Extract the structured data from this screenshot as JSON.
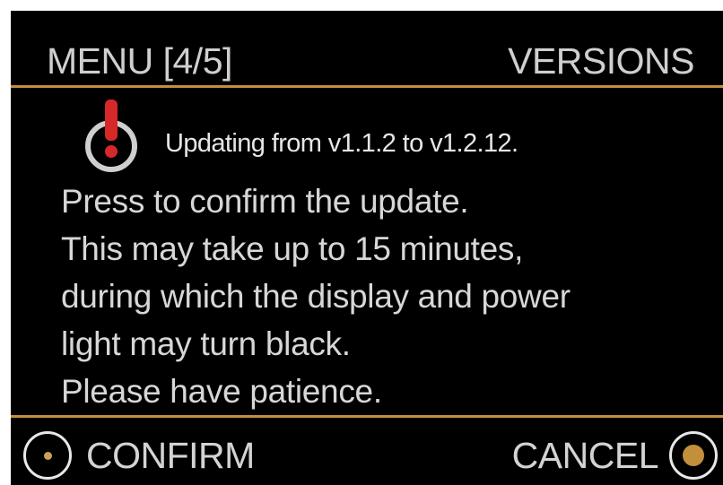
{
  "header": {
    "menu_label": "MENU [4/5]",
    "section_label": "VERSIONS"
  },
  "alert": {
    "icon": "power-alert-icon",
    "status_text": "Updating from v1.1.2 to v1.2.12."
  },
  "message": {
    "lines": [
      "Press to confirm the update.",
      "This may take up to 15 minutes,",
      "during which the display and power",
      "light may turn black.",
      "Please have patience."
    ]
  },
  "footer": {
    "confirm_label": "CONFIRM",
    "cancel_label": "CANCEL"
  },
  "colors": {
    "background": "#000000",
    "text": "#d9d9d9",
    "accent": "#c28f3d",
    "alert": "#d62828"
  }
}
